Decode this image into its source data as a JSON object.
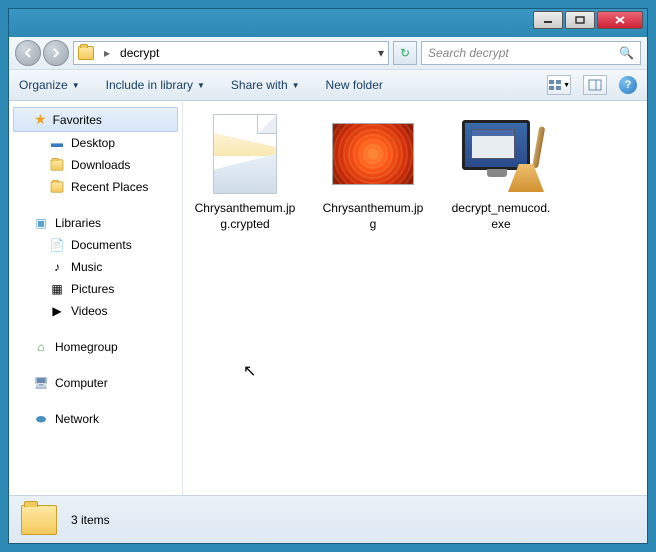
{
  "window": {
    "path_segment": "decrypt",
    "search_placeholder": "Search decrypt"
  },
  "toolbar": {
    "organize": "Organize",
    "include": "Include in library",
    "share": "Share with",
    "newfolder": "New folder"
  },
  "sidebar": {
    "favorites": {
      "label": "Favorites",
      "items": [
        "Desktop",
        "Downloads",
        "Recent Places"
      ]
    },
    "libraries": {
      "label": "Libraries",
      "items": [
        "Documents",
        "Music",
        "Pictures",
        "Videos"
      ]
    },
    "homegroup": {
      "label": "Homegroup"
    },
    "computer": {
      "label": "Computer"
    },
    "network": {
      "label": "Network"
    }
  },
  "files": [
    {
      "name": "Chrysanthemum.jpg.crypted",
      "type": "crypted"
    },
    {
      "name": "Chrysanthemum.jpg",
      "type": "image"
    },
    {
      "name": "decrypt_nemucod.exe",
      "type": "exe"
    }
  ],
  "status": {
    "text": "3 items"
  }
}
